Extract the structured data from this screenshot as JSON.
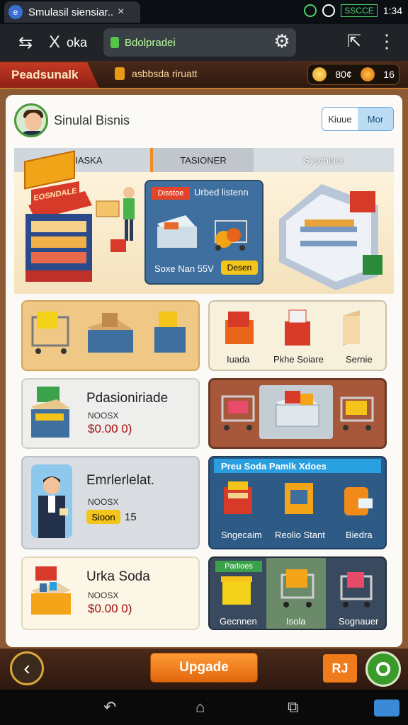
{
  "status_bar": {
    "tab_title": "Smulasil siensiar..",
    "tab_close": "×",
    "battery_text": "SSCCE",
    "time": "1:34"
  },
  "browser": {
    "back_label": "⇆",
    "close_label": "X",
    "ok_label": "oka",
    "url": "Bdolpradei",
    "gear_icon": "⚙",
    "share_icon": "⇱",
    "menu_icon": "⋮"
  },
  "game_header": {
    "brand": "Peadsunalk",
    "subtitle": "asbbsda riruatt",
    "coin_value": "80¢",
    "gem_value": "16"
  },
  "profile": {
    "title": "Sinulal Bisnis",
    "toggle_left": "Kiuue",
    "toggle_right": "Mor"
  },
  "tabs": [
    "URIASKA",
    "TASIONER",
    "Syschlaer"
  ],
  "scene": {
    "sign_text": "EOSNDALE",
    "counter_tag": "Disstoe",
    "counter_title": "Urbed listenn",
    "counter_caption": "Soxe Nan 55V",
    "counter_btn": "Desen"
  },
  "row1_right": {
    "items": [
      "Iuada",
      "Pkhe Soiare",
      "Sernie"
    ]
  },
  "card_a": {
    "title": "Pdasioniriade",
    "code": "NOOSX",
    "price": "$0.00 0)"
  },
  "card_b": {
    "title": "Emrlerlelat.",
    "code": "NOOSX",
    "tag": "Sioon",
    "count": "15"
  },
  "blue_panel": {
    "header": "Preu Soda Pamlk Xdoes",
    "items": [
      "Sngecaim",
      "Reolio Stant",
      "Biedra"
    ]
  },
  "card_c": {
    "title": "Urka Soda",
    "code": "NOOSX",
    "price": "$0.00 0)"
  },
  "dark_panel": {
    "tag": "Parlioes",
    "items": [
      "Gecnnen",
      "Isola",
      "Sognauer"
    ]
  },
  "bottom_bar": {
    "back_icon": "‹",
    "upgrade": "Upgade",
    "r_button": "RJ"
  },
  "system_nav": {
    "back": "↶",
    "home": "⌂",
    "recent": "⧉"
  },
  "colors": {
    "accent_orange": "#f07b1a",
    "header_brown": "#4a2a1a",
    "panel_blue": "#3e6f9e",
    "green": "#3a9a2a"
  }
}
